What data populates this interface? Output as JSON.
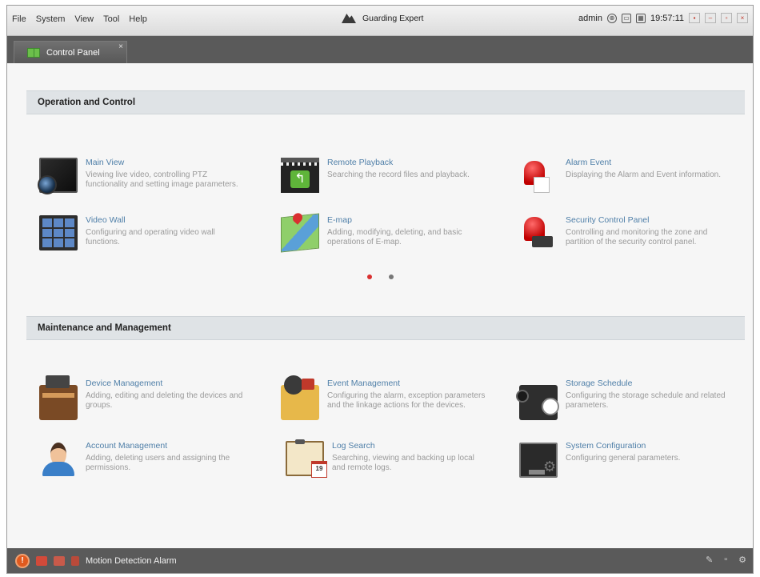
{
  "menu": [
    "File",
    "System",
    "View",
    "Tool",
    "Help"
  ],
  "app_title": "Guarding Expert",
  "status": {
    "user": "admin",
    "time": "19:57:11",
    "icons": [
      "network-icon",
      "hdd-icon",
      "keyboard-icon"
    ],
    "window_buttons": [
      "lock",
      "minimize",
      "restore",
      "close"
    ]
  },
  "tab": {
    "label": "Control Panel",
    "close": "×"
  },
  "sections": {
    "operation": {
      "title": "Operation and Control",
      "modules": [
        {
          "title": "Main View",
          "desc": "Viewing live video, controlling PTZ functionality and setting image parameters.",
          "icon": "main-view-icon"
        },
        {
          "title": "Remote Playback",
          "desc": "Searching the record files and playback.",
          "icon": "remote-playback-icon"
        },
        {
          "title": "Alarm Event",
          "desc": "Displaying the Alarm and Event information.",
          "icon": "alarm-event-icon"
        },
        {
          "title": "Video Wall",
          "desc": "Configuring and operating video wall functions.",
          "icon": "video-wall-icon"
        },
        {
          "title": "E-map",
          "desc": "Adding, modifying, deleting, and basic operations of E-map.",
          "icon": "emap-icon"
        },
        {
          "title": "Security Control Panel",
          "desc": "Controlling and monitoring the zone and partition of the security control panel.",
          "icon": "security-panel-icon"
        }
      ],
      "pager": {
        "pages": 2,
        "current": 1,
        "active_color": "#d93030",
        "inactive_color": "#777777"
      }
    },
    "maintenance": {
      "title": "Maintenance and Management",
      "modules": [
        {
          "title": "Device Management",
          "desc": "Adding, editing and deleting the devices and groups.",
          "icon": "device-management-icon"
        },
        {
          "title": "Event Management",
          "desc": "Configuring the alarm, exception parameters and the linkage actions for the devices.",
          "icon": "event-management-icon"
        },
        {
          "title": "Storage Schedule",
          "desc": "Configuring the storage schedule and related parameters.",
          "icon": "storage-schedule-icon"
        },
        {
          "title": "Account Management",
          "desc": "Adding, deleting users and assigning the permissions.",
          "icon": "account-management-icon"
        },
        {
          "title": "Log Search",
          "desc": "Searching, viewing and backing up local and remote logs.",
          "icon": "log-search-icon"
        },
        {
          "title": "System Configuration",
          "desc": "Configuring general parameters.",
          "icon": "system-configuration-icon"
        }
      ]
    }
  },
  "bottom_bar": {
    "alarm_label": "Motion Detection Alarm",
    "icons": [
      "alarm-bell-icon",
      "audio-alarm-icon",
      "video-alarm-icon",
      "motion-alarm-icon"
    ],
    "right_icons": [
      "pin-icon",
      "window-icon",
      "settings-icon"
    ]
  },
  "colors": {
    "accent": "#4f7fa8",
    "dark_bar": "#5a5a5a",
    "header_bg": "#dfe3e6"
  }
}
